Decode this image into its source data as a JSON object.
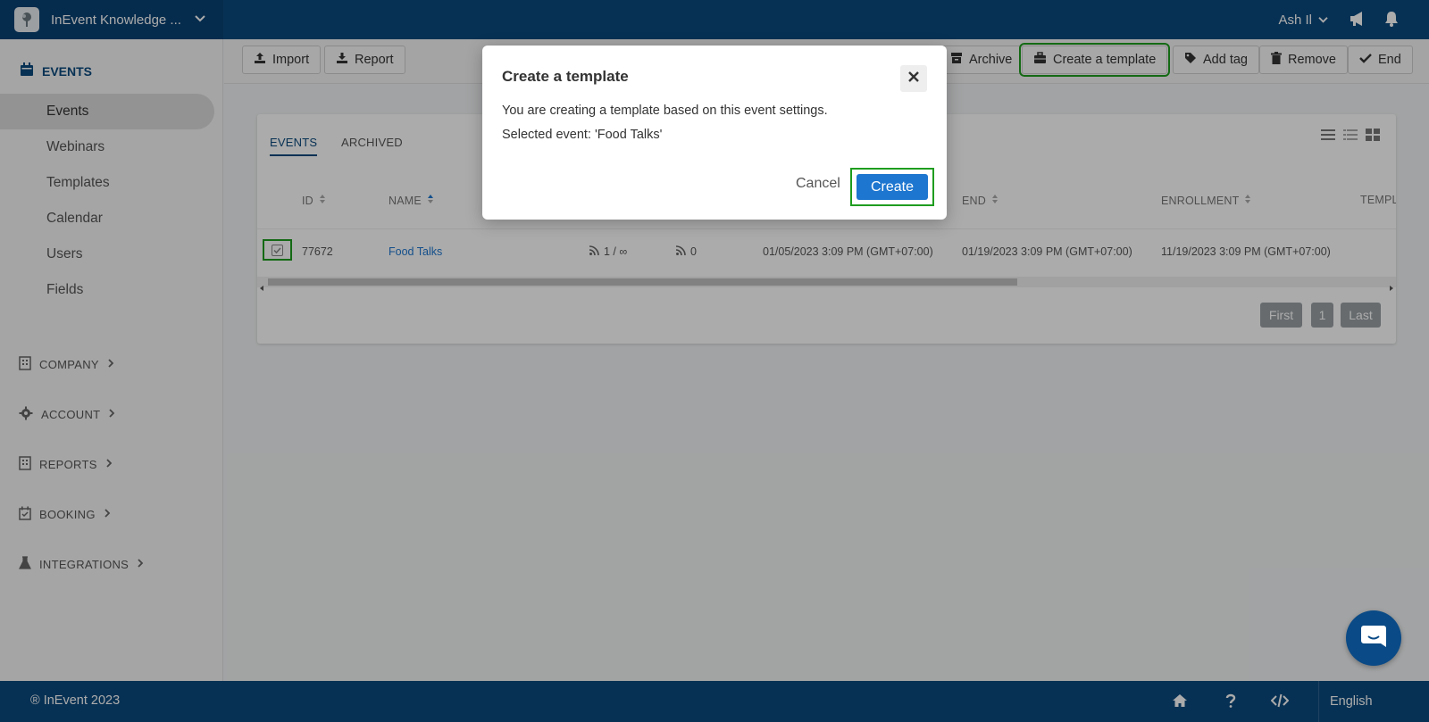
{
  "topbar": {
    "org_name": "InEvent Knowledge ...",
    "user_name": "Ash Il"
  },
  "sidebar": {
    "section_title": "EVENTS",
    "items": [
      {
        "label": "Events"
      },
      {
        "label": "Webinars"
      },
      {
        "label": "Templates"
      },
      {
        "label": "Calendar"
      },
      {
        "label": "Users"
      },
      {
        "label": "Fields"
      }
    ],
    "sections": [
      {
        "label": "COMPANY"
      },
      {
        "label": "ACCOUNT"
      },
      {
        "label": "REPORTS"
      },
      {
        "label": "BOOKING"
      },
      {
        "label": "INTEGRATIONS"
      }
    ]
  },
  "toolbar": {
    "import": "Import",
    "report": "Report",
    "archive": "Archive",
    "create_template": "Create a template",
    "add_tag": "Add tag",
    "remove": "Remove",
    "end": "End"
  },
  "table": {
    "tabs": [
      "EVENTS",
      "ARCHIVED"
    ],
    "headers": {
      "id": "ID",
      "name": "NAME",
      "end": "END",
      "enrollment": "ENROLLMENT",
      "template": "TEMPL"
    },
    "row": {
      "id": "77672",
      "name": "Food Talks",
      "feed1": "1 / ∞",
      "feed2": "0",
      "start": "01/05/2023 3:09 PM (GMT+07:00)",
      "end": "01/19/2023 3:09 PM (GMT+07:00)",
      "enrollment": "11/19/2023 3:09 PM (GMT+07:00)"
    },
    "pagination": {
      "first": "First",
      "page": "1",
      "last": "Last"
    }
  },
  "modal": {
    "title": "Create a template",
    "line1": "You are creating a template based on this event settings.",
    "line2": "Selected event: 'Food Talks'",
    "cancel": "Cancel",
    "create": "Create"
  },
  "footer": {
    "copyright": "® InEvent 2023",
    "language": "English"
  },
  "colors": {
    "brand": "#0b4a7e",
    "primary_button": "#1d76cf",
    "highlight": "#1f9d1f"
  }
}
